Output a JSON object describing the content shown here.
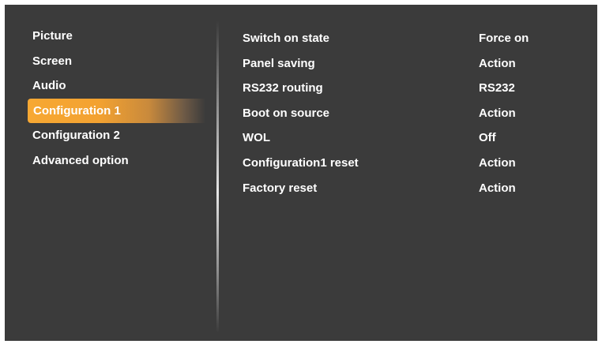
{
  "menu": {
    "items": [
      {
        "label": "Picture"
      },
      {
        "label": "Screen"
      },
      {
        "label": "Audio"
      },
      {
        "label": "Configuration 1",
        "selected": true
      },
      {
        "label": "Configuration 2"
      },
      {
        "label": "Advanced option"
      }
    ]
  },
  "settings": {
    "rows": [
      {
        "label": "Switch on state",
        "value": "Force on"
      },
      {
        "label": "Panel saving",
        "value": "Action"
      },
      {
        "label": "RS232 routing",
        "value": "RS232"
      },
      {
        "label": "Boot on source",
        "value": "Action"
      },
      {
        "label": "WOL",
        "value": "Off"
      },
      {
        "label": "Configuration1 reset",
        "value": "Action"
      },
      {
        "label": "Factory reset",
        "value": "Action"
      }
    ]
  },
  "colors": {
    "background": "#3b3b3b",
    "highlight": "#f7a833",
    "text": "#ffffff"
  }
}
